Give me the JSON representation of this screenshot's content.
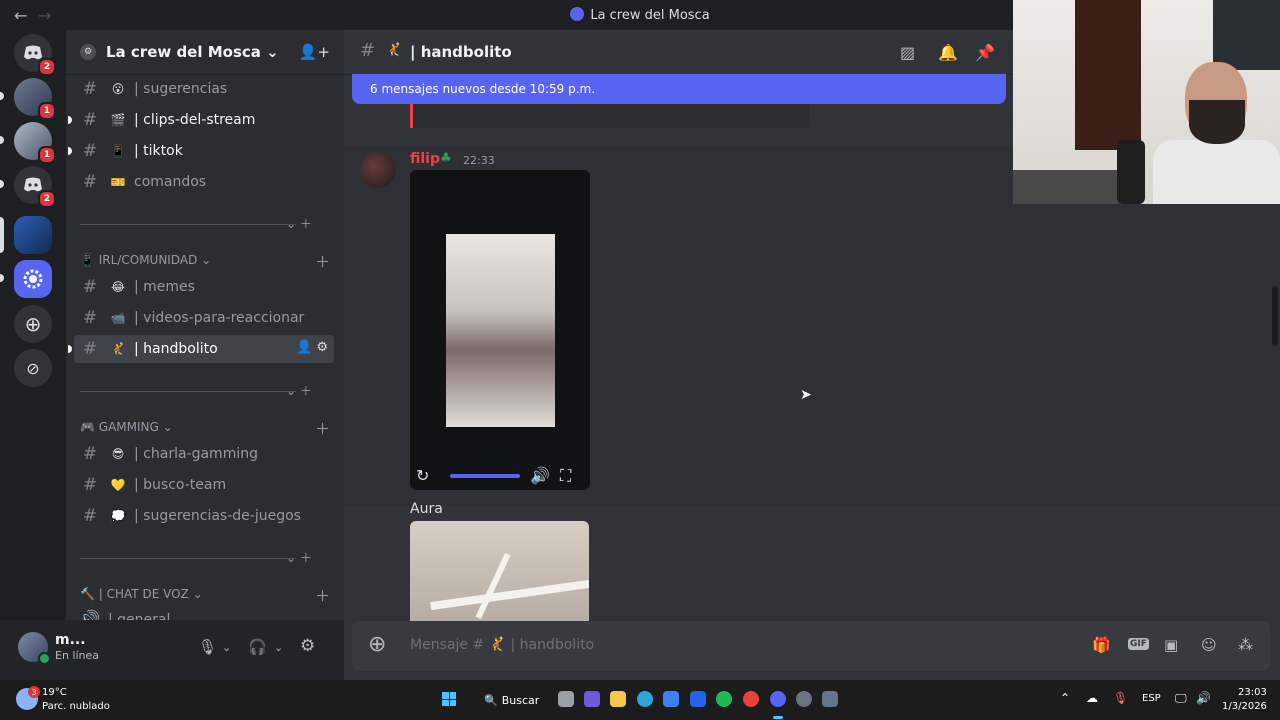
{
  "window": {
    "title": "La crew del Mosca",
    "back": "←",
    "forward": "→"
  },
  "guilds": [
    {
      "name": "discord-home",
      "badge": "2"
    },
    {
      "name": "server-1",
      "badge": "1"
    },
    {
      "name": "server-2",
      "badge": "1"
    },
    {
      "name": "discord-server",
      "badge": "2"
    },
    {
      "name": "server-active",
      "badge": ""
    },
    {
      "name": "discord-blue",
      "badge": ""
    }
  ],
  "server": {
    "name": "La crew del Mosca",
    "chevron": "⌄"
  },
  "channels": [
    {
      "emoji": "😮",
      "label": "| sugerencias"
    },
    {
      "emoji": "🎬",
      "label": "| clips-del-stream"
    },
    {
      "emoji": "📱",
      "label": "| tiktok"
    },
    {
      "emoji": "🎫",
      "label": "comandos"
    },
    {
      "emoji": "😂",
      "label": "| memes"
    },
    {
      "emoji": "📹",
      "label": "| videos-para-reaccionar"
    },
    {
      "emoji": "🤾",
      "label": "| handbolito"
    },
    {
      "emoji": "😎",
      "label": "| charla-gamming"
    },
    {
      "emoji": "💛",
      "label": "| busco-team"
    },
    {
      "emoji": "💭",
      "label": "| sugerencias-de-juegos"
    },
    {
      "emoji": "🔊",
      "label": "| general"
    }
  ],
  "categories": {
    "irl": "IRL/COMUNIDAD",
    "gaming": "GAMMING",
    "voz": "| CHAT DE VOZ"
  },
  "user": {
    "name": "m...",
    "status": "En línea"
  },
  "chat": {
    "channel": "| handbolito",
    "new_messages": "6 mensajes nuevos desde 10:59 p.m.",
    "author": "filip",
    "time": "22:33",
    "caption": "Aura",
    "placeholder": "Mensaje #",
    "placeholder_channel": "| handbolito"
  },
  "taskbar": {
    "temp": "19°C",
    "condition": "Parc. nublado",
    "weather_badge": "3",
    "search": "Buscar",
    "lang": "ESP",
    "time": "23:03",
    "date": "1/3/2026"
  },
  "colors": {
    "accent": "#5865f2",
    "author": "#f23f43",
    "online": "#23a55a"
  }
}
